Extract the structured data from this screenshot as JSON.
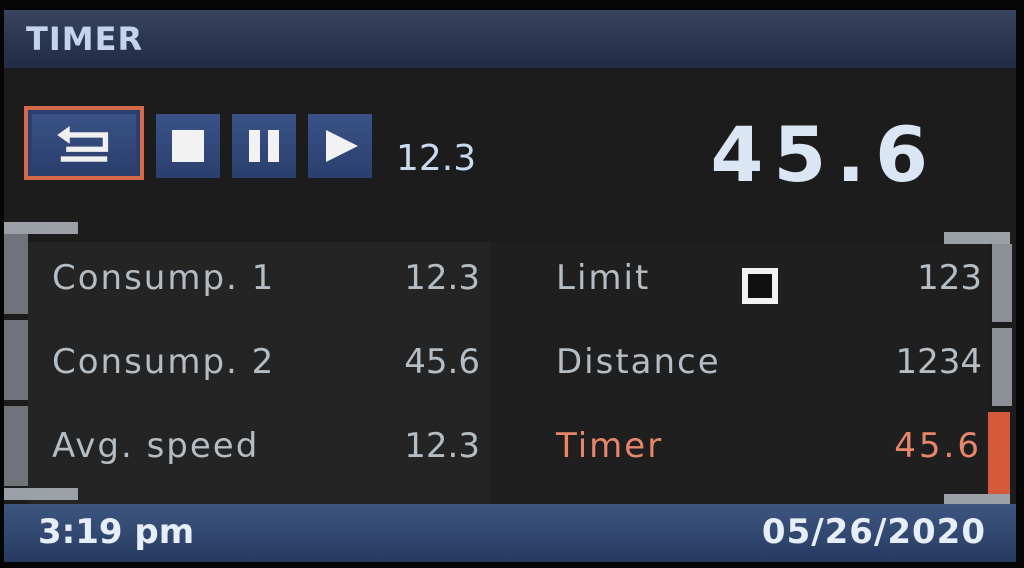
{
  "header": {
    "title": "TIMER"
  },
  "controls": {
    "back_icon": "return-arrow-icon",
    "stop_icon": "stop-icon",
    "pause_icon": "pause-icon",
    "play_icon": "play-icon",
    "small_value": "12.3",
    "big_value": "45.6"
  },
  "rows_left": [
    {
      "label": "Consump. 1",
      "value": "12.3"
    },
    {
      "label": "Consump. 2",
      "value": "45.6"
    },
    {
      "label": "Avg. speed",
      "value": "12.3"
    }
  ],
  "rows_right": [
    {
      "label": "Limit",
      "value": "123"
    },
    {
      "label": "Distance",
      "value": "1234"
    },
    {
      "label": "Timer",
      "value": "45.6"
    }
  ],
  "status": {
    "time": "3:19 pm",
    "date": "05/26/2020"
  },
  "colors": {
    "highlight": "#e8866a",
    "title_bar": "#2a3550",
    "status_bar": "#30466e",
    "selected_border": "#d46a4a"
  }
}
